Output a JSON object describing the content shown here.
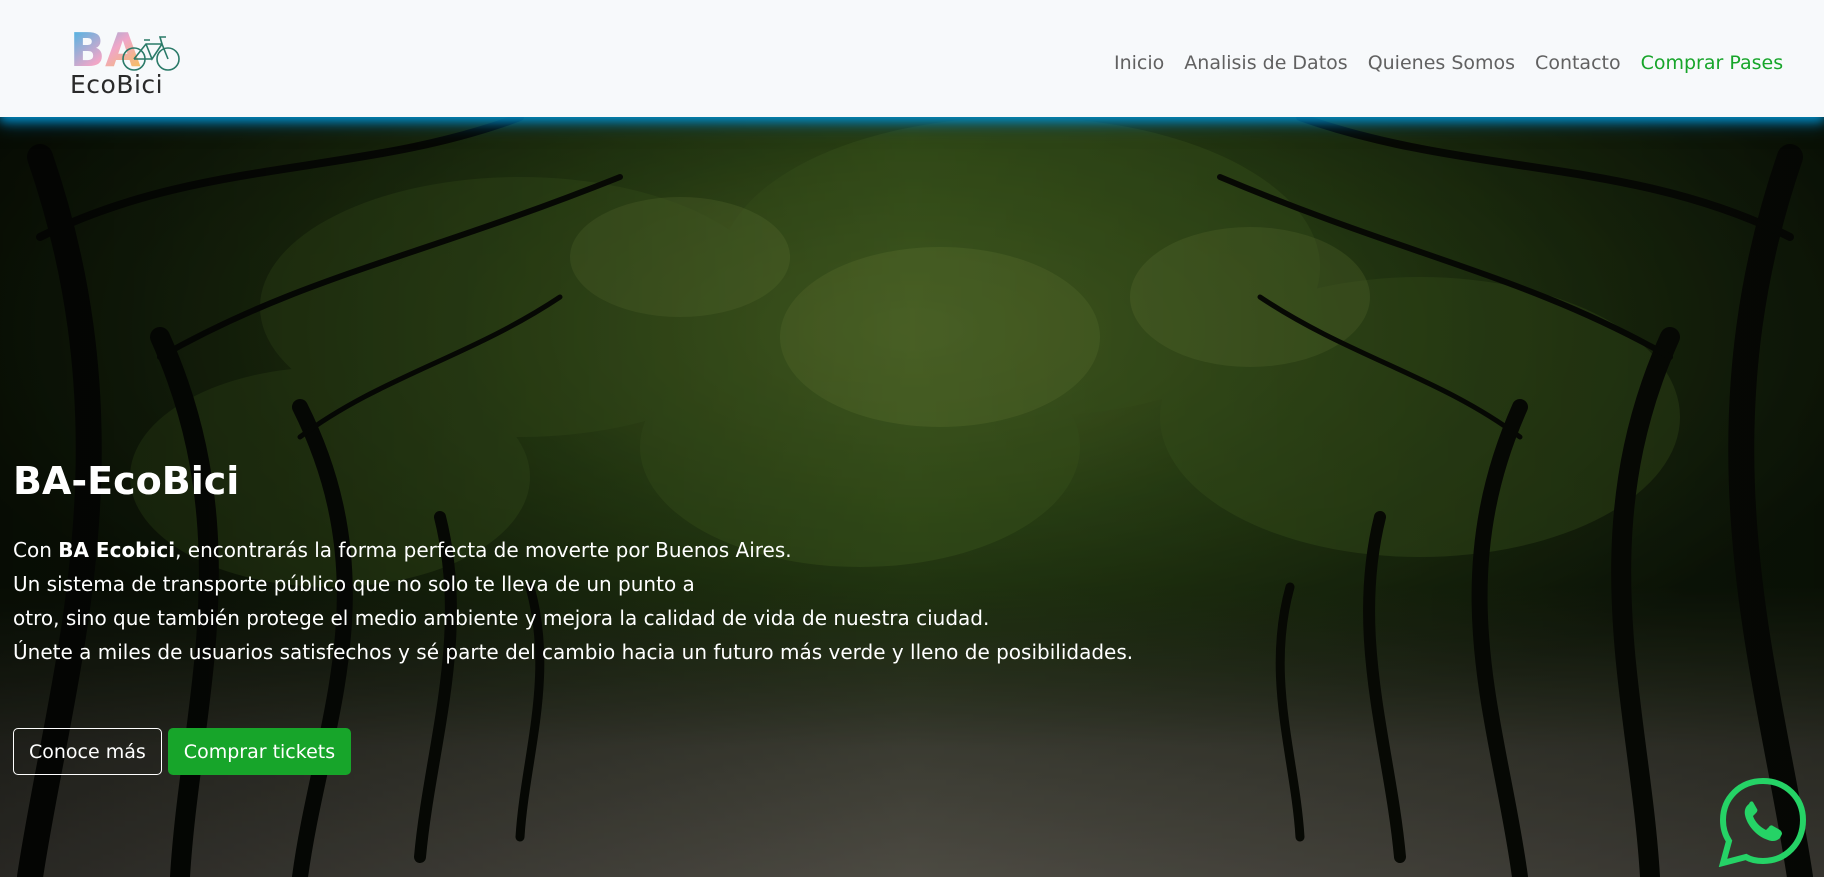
{
  "brand": {
    "logo_initials": "BA",
    "logo_text": "EcoBici"
  },
  "nav": {
    "items": [
      {
        "label": "Inicio"
      },
      {
        "label": "Analisis de Datos"
      },
      {
        "label": "Quienes Somos"
      },
      {
        "label": "Contacto"
      },
      {
        "label": "Comprar Pases",
        "accent": true
      }
    ]
  },
  "hero": {
    "title": "BA-EcoBici",
    "intro_prefix": "Con ",
    "intro_bold": "BA Ecobici",
    "intro_suffix": ", encontrarás la forma perfecta de moverte por Buenos Aires.",
    "line2": "Un sistema de transporte público que no solo te lleva de un punto a",
    "line3": "otro, sino que también protege el medio ambiente y mejora la calidad de vida de nuestra ciudad.",
    "line4": "Únete a miles de usuarios satisfechos y sé parte del cambio hacia un futuro más verde y lleno de posibilidades.",
    "primary_button": "Conoce más",
    "secondary_button": "Comprar tickets"
  },
  "icons": {
    "whatsapp": "whatsapp-icon",
    "bicycle": "bicycle-icon"
  },
  "colors": {
    "accent": "#17a52a",
    "navbar_bg": "#f7f9fb",
    "nav_text": "#616161",
    "whatsapp": "#25d366",
    "nav_shadow": "#0096d2"
  }
}
